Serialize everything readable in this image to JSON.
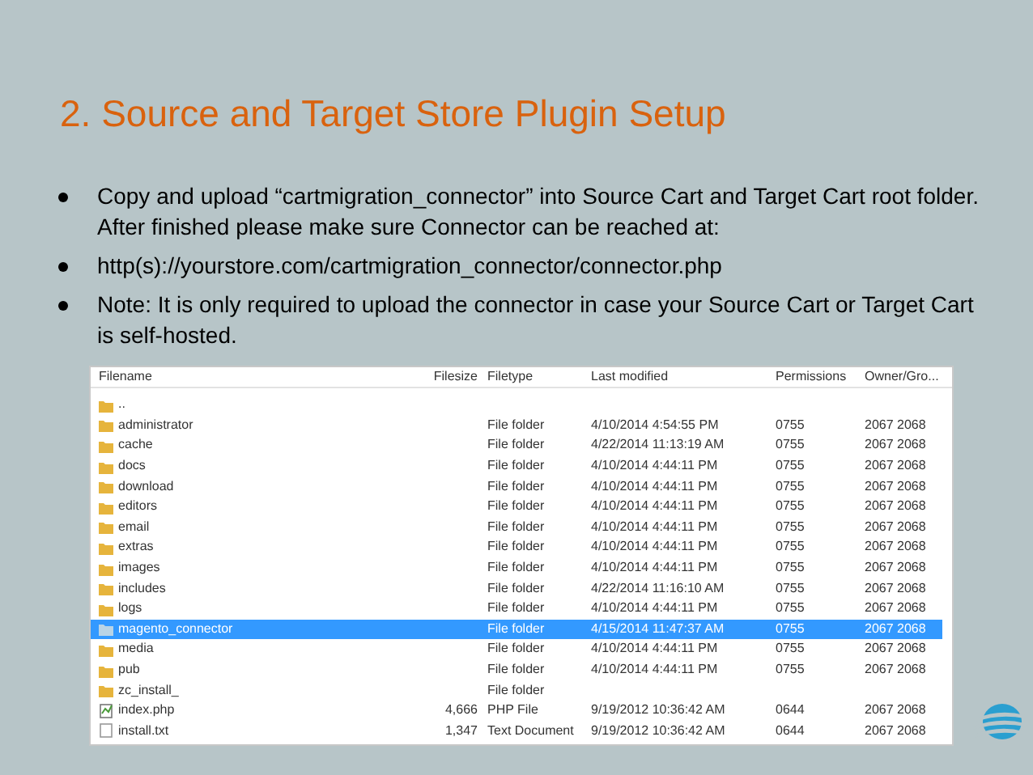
{
  "title": "2. Source and Target Store Plugin Setup",
  "bullets": [
    "Copy and upload “cartmigration_connector” into Source Cart and Target Cart root folder. After finished please make sure Connector can be reached at:",
    "http(s)://yourstore.com/cartmigration_connector/connector.php",
    "Note: It is only required to upload the connector in case your Source Cart or Target Cart is self-hosted."
  ],
  "file_list": {
    "columns": [
      "Filename",
      "Filesize",
      "Filetype",
      "Last modified",
      "Permissions",
      "Owner/Gro..."
    ],
    "rows": [
      {
        "kind": "parent",
        "selected": false,
        "cells": [
          "..",
          "",
          "",
          "",
          "",
          ""
        ]
      },
      {
        "kind": "folder",
        "selected": false,
        "cells": [
          "administrator",
          "",
          "File folder",
          "4/10/2014 4:54:55 PM",
          "0755",
          "2067 2068"
        ]
      },
      {
        "kind": "folder",
        "selected": false,
        "cells": [
          "cache",
          "",
          "File folder",
          "4/22/2014 11:13:19 AM",
          "0755",
          "2067 2068"
        ]
      },
      {
        "kind": "folder",
        "selected": false,
        "cells": [
          "docs",
          "",
          "File folder",
          "4/10/2014 4:44:11 PM",
          "0755",
          "2067 2068"
        ]
      },
      {
        "kind": "folder",
        "selected": false,
        "cells": [
          "download",
          "",
          "File folder",
          "4/10/2014 4:44:11 PM",
          "0755",
          "2067 2068"
        ]
      },
      {
        "kind": "folder",
        "selected": false,
        "cells": [
          "editors",
          "",
          "File folder",
          "4/10/2014 4:44:11 PM",
          "0755",
          "2067 2068"
        ]
      },
      {
        "kind": "folder",
        "selected": false,
        "cells": [
          "email",
          "",
          "File folder",
          "4/10/2014 4:44:11 PM",
          "0755",
          "2067 2068"
        ]
      },
      {
        "kind": "folder",
        "selected": false,
        "cells": [
          "extras",
          "",
          "File folder",
          "4/10/2014 4:44:11 PM",
          "0755",
          "2067 2068"
        ]
      },
      {
        "kind": "folder",
        "selected": false,
        "cells": [
          "images",
          "",
          "File folder",
          "4/10/2014 4:44:11 PM",
          "0755",
          "2067 2068"
        ]
      },
      {
        "kind": "folder",
        "selected": false,
        "cells": [
          "includes",
          "",
          "File folder",
          "4/22/2014 11:16:10 AM",
          "0755",
          "2067 2068"
        ]
      },
      {
        "kind": "folder",
        "selected": false,
        "cells": [
          "logs",
          "",
          "File folder",
          "4/10/2014 4:44:11 PM",
          "0755",
          "2067 2068"
        ]
      },
      {
        "kind": "folder",
        "selected": true,
        "cells": [
          "magento_connector",
          "",
          "File folder",
          "4/15/2014 11:47:37 AM",
          "0755",
          "2067 2068"
        ]
      },
      {
        "kind": "folder",
        "selected": false,
        "cells": [
          "media",
          "",
          "File folder",
          "4/10/2014 4:44:11 PM",
          "0755",
          "2067 2068"
        ]
      },
      {
        "kind": "folder",
        "selected": false,
        "cells": [
          "pub",
          "",
          "File folder",
          "4/10/2014 4:44:11 PM",
          "0755",
          "2067 2068"
        ]
      },
      {
        "kind": "folder",
        "selected": false,
        "cells": [
          "zc_install_",
          "",
          "File folder",
          "",
          "",
          ""
        ]
      },
      {
        "kind": "script",
        "selected": false,
        "cells": [
          "index.php",
          "4,666",
          "PHP File",
          "9/19/2012 10:36:42 AM",
          "0644",
          "2067 2068"
        ]
      },
      {
        "kind": "text",
        "selected": false,
        "cells": [
          "install.txt",
          "1,347",
          "Text Document",
          "9/19/2012 10:36:42 AM",
          "0644",
          "2067 2068"
        ]
      }
    ]
  }
}
